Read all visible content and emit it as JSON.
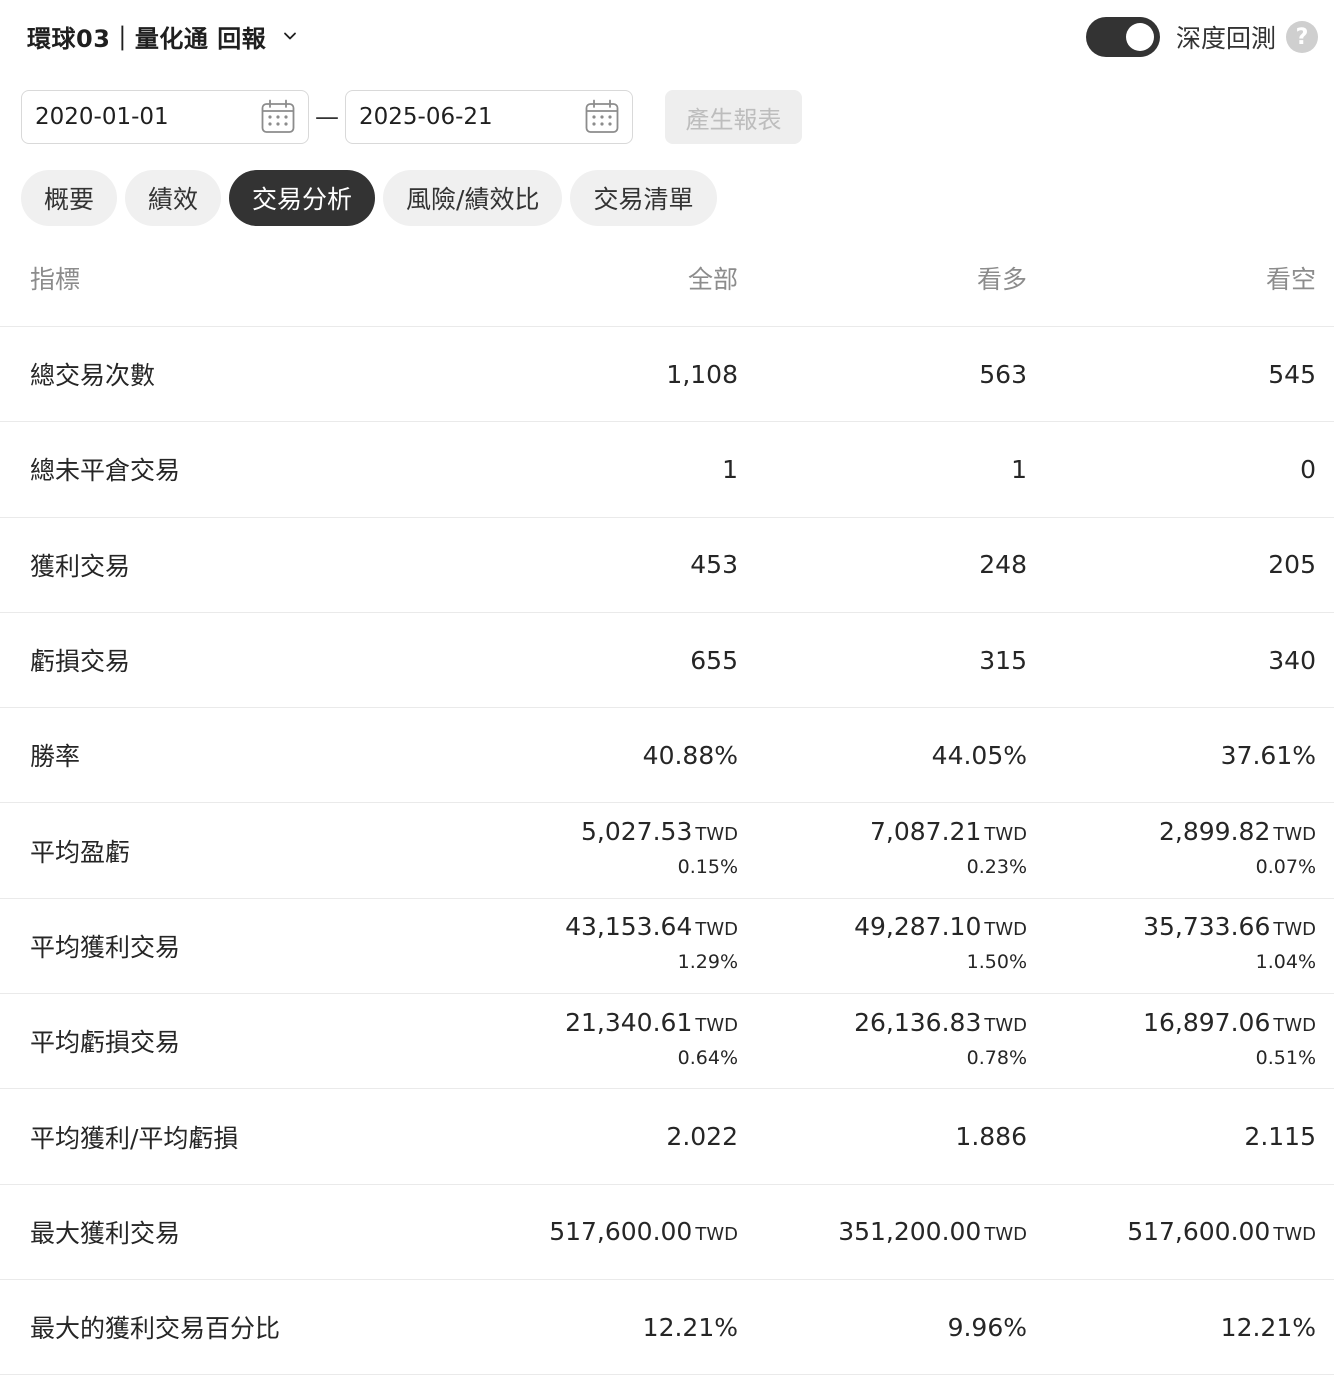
{
  "header": {
    "title": "環球03｜量化通 回報",
    "chevron_icon": "chevron-down-icon",
    "toggle_label": "深度回測",
    "toggle_on": true,
    "help_glyph": "?"
  },
  "dates": {
    "start": "2020-01-01",
    "separator": "—",
    "end": "2025-06-21",
    "generate_label": "產生報表"
  },
  "tabs": [
    {
      "label": "概要",
      "active": false
    },
    {
      "label": "績效",
      "active": false
    },
    {
      "label": "交易分析",
      "active": true
    },
    {
      "label": "風險/績效比",
      "active": false
    },
    {
      "label": "交易清單",
      "active": false
    }
  ],
  "table": {
    "headers": [
      "指標",
      "全部",
      "看多",
      "看空"
    ],
    "rows": [
      {
        "label": "總交易次數",
        "cells": [
          {
            "v": "1,108"
          },
          {
            "v": "563"
          },
          {
            "v": "545"
          }
        ]
      },
      {
        "label": "總未平倉交易",
        "cells": [
          {
            "v": "1"
          },
          {
            "v": "1"
          },
          {
            "v": "0"
          }
        ]
      },
      {
        "label": "獲利交易",
        "cells": [
          {
            "v": "453"
          },
          {
            "v": "248"
          },
          {
            "v": "205"
          }
        ]
      },
      {
        "label": "虧損交易",
        "cells": [
          {
            "v": "655"
          },
          {
            "v": "315"
          },
          {
            "v": "340"
          }
        ]
      },
      {
        "label": "勝率",
        "cells": [
          {
            "v": "40.88%"
          },
          {
            "v": "44.05%"
          },
          {
            "v": "37.61%"
          }
        ]
      },
      {
        "label": "平均盈虧",
        "cells": [
          {
            "v": "5,027.53",
            "u": "TWD",
            "p": "0.15%"
          },
          {
            "v": "7,087.21",
            "u": "TWD",
            "p": "0.23%"
          },
          {
            "v": "2,899.82",
            "u": "TWD",
            "p": "0.07%"
          }
        ]
      },
      {
        "label": "平均獲利交易",
        "cells": [
          {
            "v": "43,153.64",
            "u": "TWD",
            "p": "1.29%"
          },
          {
            "v": "49,287.10",
            "u": "TWD",
            "p": "1.50%"
          },
          {
            "v": "35,733.66",
            "u": "TWD",
            "p": "1.04%"
          }
        ]
      },
      {
        "label": "平均虧損交易",
        "cells": [
          {
            "v": "21,340.61",
            "u": "TWD",
            "p": "0.64%"
          },
          {
            "v": "26,136.83",
            "u": "TWD",
            "p": "0.78%"
          },
          {
            "v": "16,897.06",
            "u": "TWD",
            "p": "0.51%"
          }
        ]
      },
      {
        "label": "平均獲利/平均虧損",
        "cells": [
          {
            "v": "2.022"
          },
          {
            "v": "1.886"
          },
          {
            "v": "2.115"
          }
        ]
      },
      {
        "label": "最大獲利交易",
        "cells": [
          {
            "v": "517,600.00",
            "u": "TWD"
          },
          {
            "v": "351,200.00",
            "u": "TWD"
          },
          {
            "v": "517,600.00",
            "u": "TWD"
          }
        ]
      },
      {
        "label": "最大的獲利交易百分比",
        "cells": [
          {
            "v": "12.21%"
          },
          {
            "v": "9.96%"
          },
          {
            "v": "12.21%"
          }
        ]
      }
    ]
  },
  "colors": {
    "accent_dark": "#333333",
    "tab_bg": "#f0f0f0",
    "header_text": "#8c8c8c",
    "divider": "#eaeaea"
  }
}
